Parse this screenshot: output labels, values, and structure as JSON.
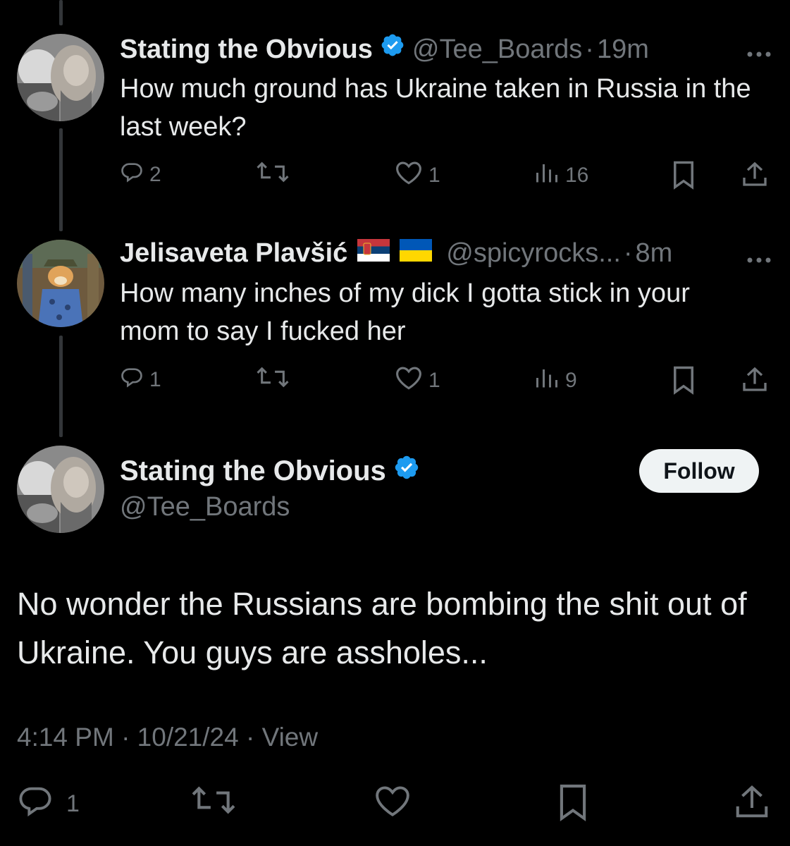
{
  "colors": {
    "background": "#000000",
    "text": "#e7e9ea",
    "muted": "#71767b",
    "verified": "#1d9bf0",
    "thread_line": "#333639"
  },
  "tweets": [
    {
      "name": "Stating the Obvious",
      "verified": true,
      "handle": "@Tee_Boards",
      "sep": "·",
      "time": "19m",
      "text": "How much ground has Ukraine taken in Russia in the last week?",
      "replies": "2",
      "likes": "1",
      "views": "16"
    },
    {
      "name": "Jelisaveta Plavšić",
      "flags": [
        "serbia-flag-icon",
        "ukraine-flag-icon"
      ],
      "handle": "@spicyrocks...",
      "sep": "·",
      "time": "8m",
      "text": "How many inches of my dick I gotta stick in your mom to say I fucked her",
      "replies": "1",
      "likes": "1",
      "views": "9"
    }
  ],
  "main": {
    "name": "Stating the Obvious",
    "verified": true,
    "handle": "@Tee_Boards",
    "follow_label": "Follow",
    "text": "No wonder the Russians are bombing the shit out of Ukraine. You guys are assholes...",
    "timestamp": "4:14 PM · 10/21/24 · View",
    "replies": "1"
  },
  "icons": [
    "reply-icon",
    "retweet-icon",
    "like-icon",
    "views-icon",
    "bookmark-icon",
    "share-icon",
    "more-icon",
    "verified-badge-icon"
  ]
}
